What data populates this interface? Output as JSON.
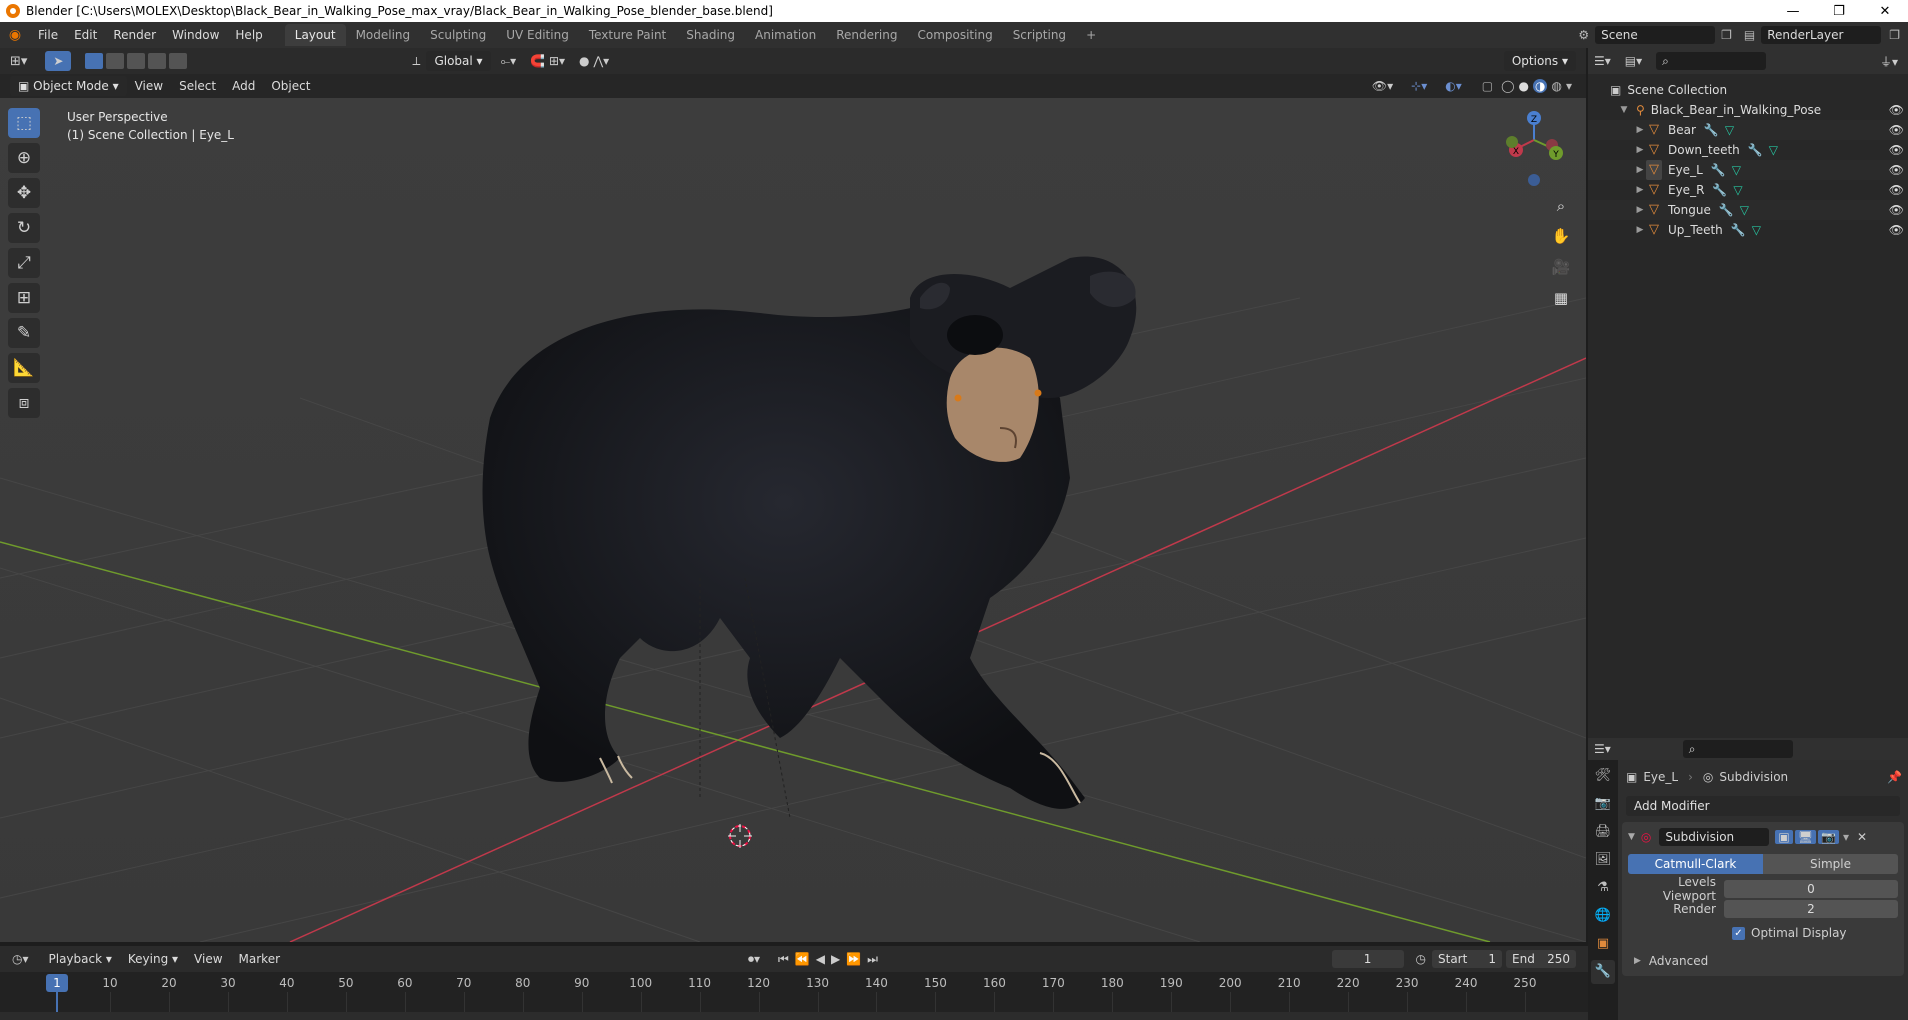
{
  "window": {
    "title": "Blender [C:\\Users\\MOLEX\\Desktop\\Black_Bear_in_Walking_Pose_max_vray/Black_Bear_in_Walking_Pose_blender_base.blend]",
    "min": "—",
    "max": "❐",
    "close": "✕"
  },
  "menu": [
    "File",
    "Edit",
    "Render",
    "Window",
    "Help"
  ],
  "workspaces": [
    "Layout",
    "Modeling",
    "Sculpting",
    "UV Editing",
    "Texture Paint",
    "Shading",
    "Animation",
    "Rendering",
    "Compositing",
    "Scripting"
  ],
  "workspace_add": "+",
  "scene": {
    "label": "Scene",
    "view_layer": "RenderLayer"
  },
  "header": {
    "orientation": "Global",
    "options": "Options",
    "mode": "Object Mode",
    "view": "View",
    "select": "Select",
    "add": "Add",
    "object": "Object"
  },
  "viewport": {
    "line1": "User Perspective",
    "line2": "(1) Scene Collection | Eye_L",
    "gizmo": {
      "x": "X",
      "y": "Y",
      "z": "Z"
    }
  },
  "outliner": {
    "root": "Scene Collection",
    "collection": "Black_Bear_in_Walking_Pose",
    "items": [
      {
        "label": "Bear"
      },
      {
        "label": "Down_teeth"
      },
      {
        "label": "Eye_L"
      },
      {
        "label": "Eye_R"
      },
      {
        "label": "Tongue"
      },
      {
        "label": "Up_Teeth"
      }
    ]
  },
  "properties": {
    "object": "Eye_L",
    "modifier_context": "Subdivision",
    "add_modifier": "Add Modifier",
    "modifier_name": "Subdivision",
    "tab_catmull": "Catmull-Clark",
    "tab_simple": "Simple",
    "levels_label": "Levels Viewport",
    "levels_value": "0",
    "render_label": "Render",
    "render_value": "2",
    "optimal_label": "Optimal Display",
    "optimal_checked": true,
    "advanced": "Advanced"
  },
  "timeline": {
    "playback": "Playback",
    "keying": "Keying",
    "view": "View",
    "marker": "Marker",
    "current_frame": "1",
    "start_label": "Start",
    "start": "1",
    "end_label": "End",
    "end": "250",
    "ticks": [
      "1",
      "10",
      "20",
      "30",
      "40",
      "50",
      "60",
      "70",
      "80",
      "90",
      "100",
      "110",
      "120",
      "130",
      "140",
      "150",
      "160",
      "170",
      "180",
      "190",
      "200",
      "210",
      "220",
      "230",
      "240",
      "250"
    ]
  },
  "colors": {
    "accent": "#4772b3",
    "x_axis": "#c0394b",
    "y_axis": "#6f9b2c",
    "bear_fur": "#17181c",
    "muzzle": "#a8876a"
  }
}
